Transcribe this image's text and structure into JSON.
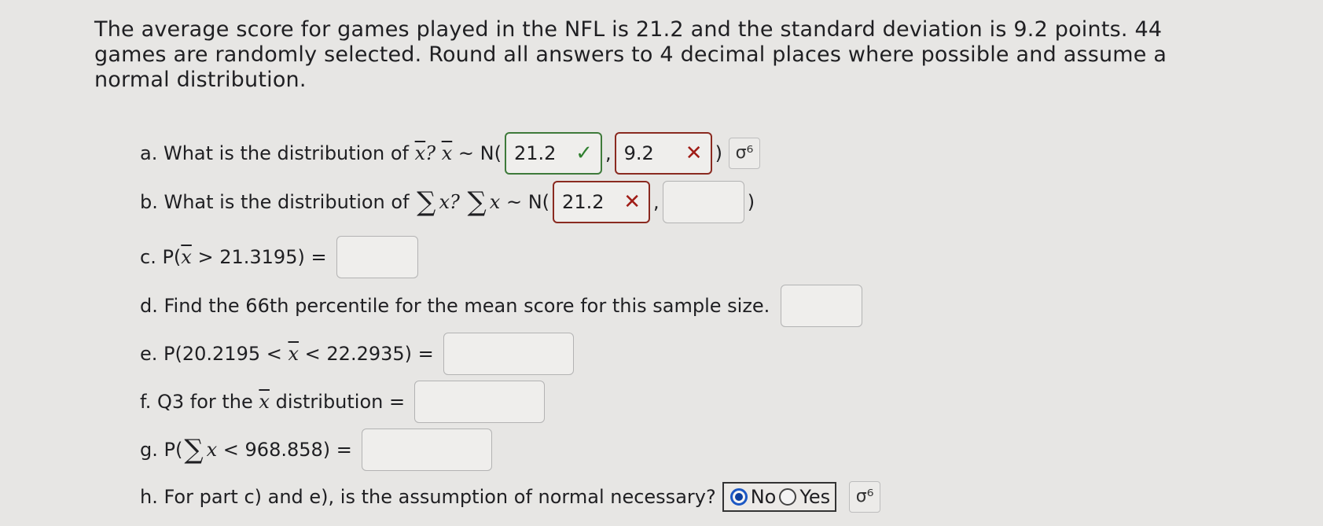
{
  "intro": "The average score for games played in the NFL is 21.2 and the standard deviation is 9.2 points. 44 games are randomly selected. Round all answers to 4 decimal places where possible and assume a normal distribution.",
  "a": {
    "label": "a. What is the distribution of",
    "xbar": "x",
    "q": "?",
    "tilde": "~ N(",
    "mean_value": "21.2",
    "sd_value": "9.2",
    "close": ")",
    "comma": ","
  },
  "b": {
    "label": "b. What is the distribution of",
    "sigma": "∑",
    "x": "x",
    "q": "?",
    "tilde": "~ N(",
    "mean_value": "21.2",
    "sd_value": "",
    "close": ")",
    "comma": ","
  },
  "c": {
    "prefix": "c. P(",
    "xbar": "x",
    "rest": "> 21.3195) =",
    "value": ""
  },
  "d": {
    "label": "d. Find the 66th percentile for the mean score for this sample size.",
    "value": ""
  },
  "e": {
    "prefix": "e. P(20.2195 <",
    "xbar": "x",
    "rest": "< 22.2935) =",
    "value": ""
  },
  "f": {
    "prefix": "f. Q3 for the",
    "xbar": "x",
    "rest": "distribution =",
    "value": ""
  },
  "g": {
    "prefix": "g. P(",
    "sigma": "∑",
    "x": "x",
    "rest": "< 968.858) =",
    "value": ""
  },
  "h": {
    "label": "h. For part c) and e), is the assumption of normal necessary?",
    "options": [
      "No",
      "Yes"
    ],
    "selected": "No"
  },
  "icons": {
    "check": "✓",
    "cross": "✕",
    "grade": "σ⁶"
  }
}
